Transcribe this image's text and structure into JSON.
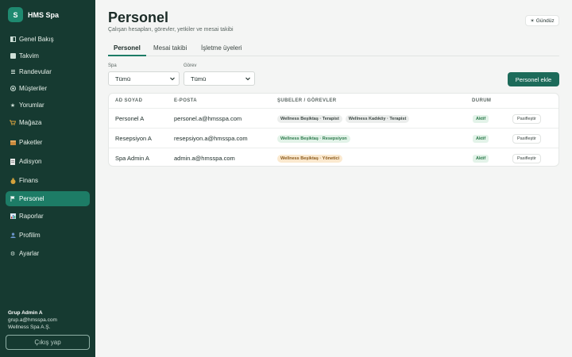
{
  "app": {
    "logo_letter": "S",
    "name": "HMS Spa"
  },
  "sidebar": {
    "items": [
      {
        "label": "Genel Bakış",
        "icon": "overview-icon"
      },
      {
        "label": "Takvim",
        "icon": "calendar-icon"
      },
      {
        "label": "Randevular",
        "icon": "appointments-icon"
      },
      {
        "label": "Müşteriler",
        "icon": "customers-icon"
      },
      {
        "label": "Yorumlar",
        "icon": "star-icon"
      },
      {
        "label": "Mağaza",
        "icon": "cart-icon"
      },
      {
        "label": "Paketler",
        "icon": "package-icon"
      },
      {
        "label": "Adisyon",
        "icon": "receipt-icon"
      },
      {
        "label": "Finans",
        "icon": "money-bag-icon"
      },
      {
        "label": "Personel",
        "icon": "flag-icon",
        "active": true
      },
      {
        "label": "Raporlar",
        "icon": "bar-chart-icon"
      },
      {
        "label": "Profilim",
        "icon": "user-icon"
      },
      {
        "label": "Ayarlar",
        "icon": "gear-icon"
      }
    ],
    "user": {
      "name": "Grup Admin A",
      "email": "grup.a@hmsspa.com",
      "company": "Wellness Spa A.Ş."
    },
    "logout_label": "Çıkış yap"
  },
  "header": {
    "title": "Personel",
    "subtitle": "Çalışan hesapları, görevler, yetkiler ve mesai takibi",
    "theme_label": "Gündüz"
  },
  "tabs": [
    {
      "label": "Personel",
      "active": true
    },
    {
      "label": "Mesai takibi"
    },
    {
      "label": "İşletme üyeleri"
    }
  ],
  "filters": {
    "spa": {
      "label": "Spa",
      "value": "Tümü"
    },
    "role": {
      "label": "Görev",
      "value": "Tümü"
    }
  },
  "add_button_label": "Personel ekle",
  "table": {
    "columns": [
      "AD SOYAD",
      "E-POSTA",
      "ŞUBELER / GÖREVLER",
      "DURUM"
    ],
    "rows": [
      {
        "name": "Personel A",
        "email": "personel.a@hmsspa.com",
        "roles": [
          {
            "text": "Wellness Beşiktaş · Terapist",
            "color": "gray"
          },
          {
            "text": "Wellness Kadıköy · Terapist",
            "color": "gray"
          }
        ],
        "status": "Aktif",
        "action": "Pasifleştir"
      },
      {
        "name": "Resepsiyon A",
        "email": "resepsiyon.a@hmsspa.com",
        "roles": [
          {
            "text": "Wellness Beşiktaş · Resepsiyon",
            "color": "green"
          }
        ],
        "status": "Aktif",
        "action": "Pasifleştir"
      },
      {
        "name": "Spa Admin A",
        "email": "admin.a@hmsspa.com",
        "roles": [
          {
            "text": "Wellness Beşiktaş · Yönetici",
            "color": "amber"
          }
        ],
        "status": "Aktif",
        "action": "Pasifleştir"
      }
    ]
  },
  "colors": {
    "sidebar_bg": "#163a31",
    "active_nav": "#1d7c66",
    "primary_button": "#1d6b5a",
    "status_active": "#2c7a4b"
  }
}
